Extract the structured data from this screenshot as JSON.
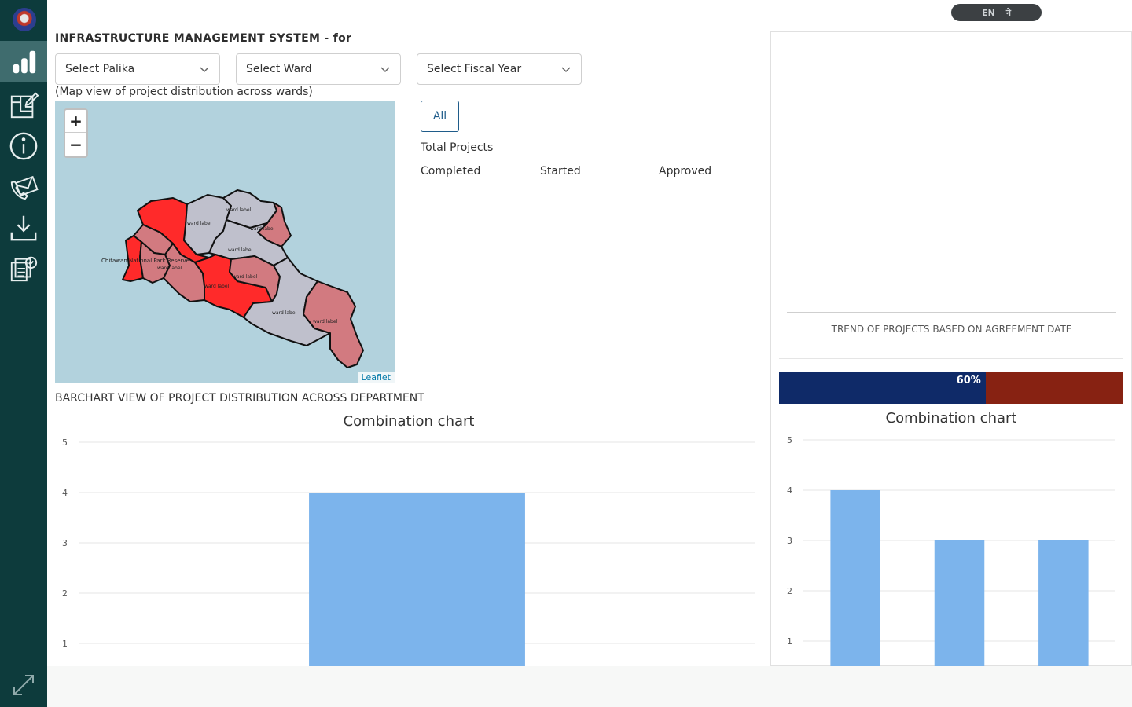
{
  "header": {
    "title": "INFRASTRUCTURE MANAGEMENT SYSTEM - for",
    "lang_en": "EN",
    "lang_ne": "ने"
  },
  "filters": {
    "palika": "Select Palika",
    "ward": "Select Ward",
    "fiscal_year": "Select Fiscal Year"
  },
  "map": {
    "caption": "(Map view of project distribution across wards)",
    "zoom_in": "+",
    "zoom_out": "−",
    "attribution": "Leaflet",
    "outside_label": "Chitawan National Park Reserve",
    "colors": {
      "water": "#b2d2dd",
      "high": "#ff2a2a",
      "medium": "#d27a80",
      "none": "#bfc0cc"
    }
  },
  "stats": {
    "all_button": "All",
    "total_projects": "Total Projects",
    "completed": "Completed",
    "started": "Started",
    "approved": "Approved"
  },
  "bar_section": {
    "label": "BARCHART VIEW OF PROJECT DISTRIBUTION ACROSS DEPARTMENT"
  },
  "right_panel": {
    "trend_label": "TREND OF PROJECTS BASED ON AGREEMENT DATE",
    "progress_label": "60%",
    "progress_value": 0.6,
    "progress_colors": {
      "fill": "#0f2a68",
      "rest": "#872212"
    }
  },
  "chart_data": [
    {
      "type": "bar",
      "title": "Combination chart",
      "categories": [
        "",
        "",
        ""
      ],
      "values": [
        0,
        4,
        0
      ],
      "yticks": [
        1,
        2,
        3,
        4,
        5
      ],
      "ylim": [
        0,
        5
      ],
      "grid": true,
      "color": "#7cb4ec"
    },
    {
      "type": "bar",
      "title": "Combination chart",
      "categories": [
        "",
        "",
        ""
      ],
      "values": [
        4,
        3,
        3
      ],
      "yticks": [
        1,
        2,
        3,
        4,
        5
      ],
      "ylim": [
        0,
        5
      ],
      "grid": true,
      "color": "#7cb4ec"
    }
  ]
}
